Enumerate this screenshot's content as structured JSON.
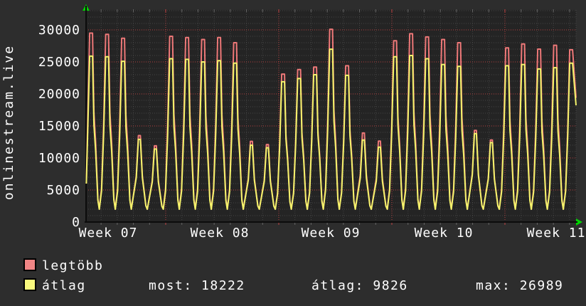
{
  "title": "onlinestream.live",
  "colors": {
    "background": "#2d2d2d",
    "plot_background": "#242424",
    "text": "#ffffff",
    "grid_minor": "#6a6a6a",
    "grid_major": "#cc4444",
    "axis": "#0b0b0b",
    "arrow": "#00d400",
    "series_max": "#ee7878",
    "series_avg": "#f3f36b"
  },
  "chart_data": {
    "type": "line",
    "title": "onlinestream.live",
    "x_axis": {
      "labels": [
        "Week 07",
        "Week 08",
        "Week 09",
        "Week 10",
        "Week 11"
      ]
    },
    "y_axis": {
      "ticks": [
        "0",
        "5000",
        "10000",
        "15000",
        "20000",
        "25000",
        "30000"
      ],
      "tick_values": [
        0,
        5000,
        10000,
        15000,
        20000,
        25000,
        30000
      ],
      "minor_step": 1000,
      "displayed_max": 33000
    },
    "grid": {
      "minor_interval_days": 1,
      "major_interval_days": 7
    },
    "valley_value": 2000,
    "series": [
      {
        "name": "legtöbb",
        "color": "#ee7878",
        "daily_peaks": [
          29500,
          29300,
          28700,
          13500,
          11900,
          29000,
          28800,
          28500,
          28800,
          28000,
          12600,
          12100,
          23100,
          23800,
          24200,
          30100,
          24400,
          13900,
          12650,
          28300,
          29400,
          28900,
          28500,
          28000,
          14300,
          12800,
          27200,
          27800,
          27000,
          27600,
          26900
        ],
        "end_value": 19400
      },
      {
        "name": "átlag",
        "color": "#f3f36b",
        "daily_peaks": [
          25900,
          25800,
          25100,
          12900,
          11400,
          25500,
          25400,
          25000,
          25200,
          24800,
          12000,
          11600,
          21900,
          22400,
          23000,
          26989,
          22900,
          12800,
          11700,
          25800,
          26000,
          25500,
          24600,
          24300,
          13800,
          12400,
          24400,
          24600,
          23900,
          24100,
          24800
        ],
        "end_value": 18222
      }
    ],
    "legend_position": "bottom-left"
  },
  "legend": {
    "entries": [
      {
        "label": "legtöbb",
        "color": "#f08585"
      },
      {
        "label": "átlag",
        "color": "#f9f97d"
      }
    ]
  },
  "stats": [
    {
      "label": "most:",
      "value": "18222"
    },
    {
      "label": "átlag:",
      "value": "9826"
    },
    {
      "label": "max:",
      "value": "26989"
    }
  ]
}
